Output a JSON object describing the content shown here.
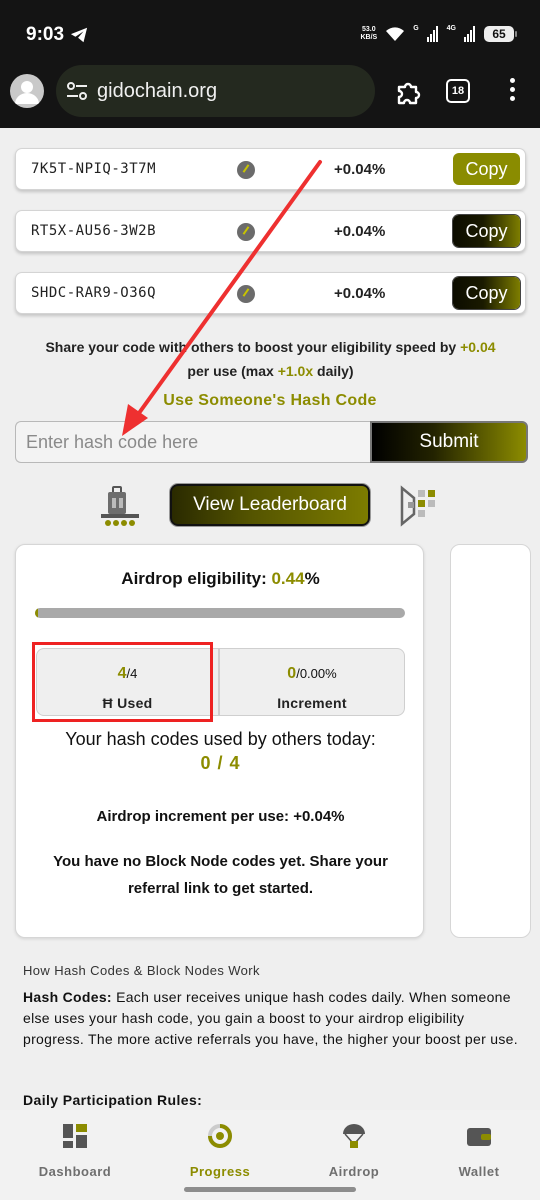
{
  "status_bar": {
    "time": "9:03",
    "net_speed_value": "53.0",
    "net_speed_unit": "KB/S",
    "signal_label_1": "G",
    "signal_label_2": "4G",
    "battery": "65"
  },
  "browser": {
    "url": "gidochain.org",
    "tab_count": "18"
  },
  "codes": [
    {
      "code": "7K5T-NPIQ-3T7M",
      "boost": "+0.04%",
      "button": "Copy"
    },
    {
      "code": "RT5X-AU56-3W2B",
      "boost": "+0.04%",
      "button": "Copy"
    },
    {
      "code": "SHDC-RAR9-O36Q",
      "boost": "+0.04%",
      "button": "Copy"
    }
  ],
  "share": {
    "text_start": "Share your code with others to boost your eligibility speed by ",
    "boost": "+0.04",
    "text_mid": "per use (",
    "max_label": "max",
    "max_value": "+1.0x",
    "text_end": " daily)"
  },
  "use_code": {
    "title": "Use Someone's Hash Code",
    "placeholder": "Enter hash code here",
    "submit": "Submit"
  },
  "leaderboard_button": "View Leaderboard",
  "card": {
    "eligibility_label": "Airdrop eligibility: ",
    "eligibility_value": "0.44",
    "eligibility_unit": "%",
    "progress_fraction": 0.0044,
    "used_value": "4",
    "used_total": "/4",
    "used_label": "Ħ Used",
    "increment_value": "0",
    "increment_total": "/0.00%",
    "increment_label": "Increment",
    "used_today_label": "Your hash codes used by others today:",
    "used_today_value": "0 / 4",
    "increment_per_use": "Airdrop increment per use: +0.04%",
    "no_codes": "You have no Block Node codes yet. Share your referral link to get started."
  },
  "info": {
    "title": "How Hash Codes & Block Nodes Work",
    "hash_codes_label": "Hash Codes:",
    "hash_codes_text": " Each user receives unique hash codes daily. When someone else uses your hash code, you gain a boost to your airdrop eligibility progress. The more active referrals you have, the higher your boost per use.",
    "rules_title": "Daily Participation Rules:"
  },
  "nav": [
    {
      "label": "Dashboard",
      "icon": "dashboard-icon"
    },
    {
      "label": "Progress",
      "icon": "progress-icon"
    },
    {
      "label": "Airdrop",
      "icon": "airdrop-icon"
    },
    {
      "label": "Wallet",
      "icon": "wallet-icon"
    }
  ],
  "colors": {
    "accent": "#8c8c00",
    "highlight": "#ee2222",
    "dark": "#141414"
  }
}
